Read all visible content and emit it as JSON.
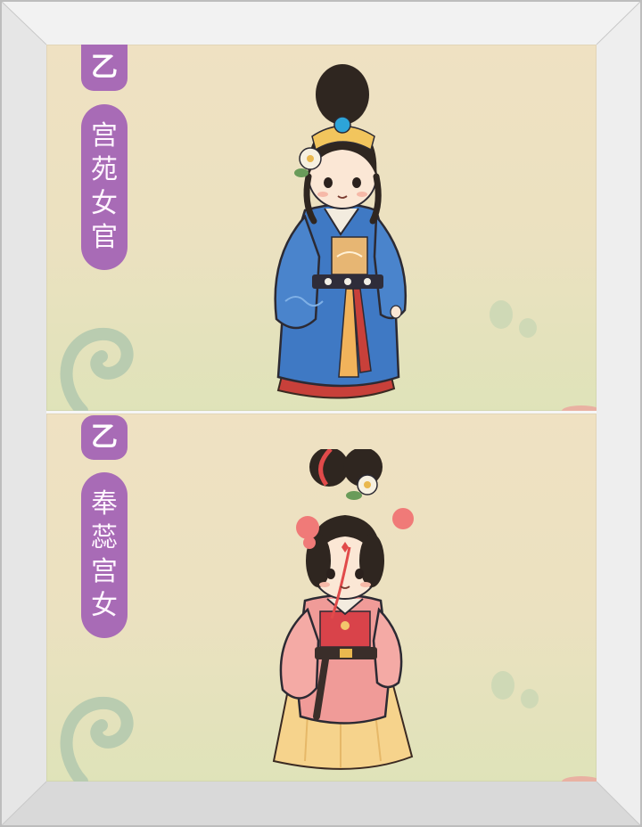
{
  "cards": [
    {
      "grade": "乙",
      "title": "宫苑女官",
      "robe_color": "#3f79c4",
      "skirt_color": "#c8403a"
    },
    {
      "grade": "乙",
      "title": "奉蕊宫女",
      "robe_color": "#f09b98",
      "skirt_color": "#f6d38c"
    }
  ],
  "colors": {
    "badge": "#a86bb6",
    "badge_text": "#ffffff",
    "card_bg": "#ebe1c0"
  },
  "icons": [
    "grade-badge",
    "cloud-swirl-decoration",
    "leaf-decoration"
  ]
}
